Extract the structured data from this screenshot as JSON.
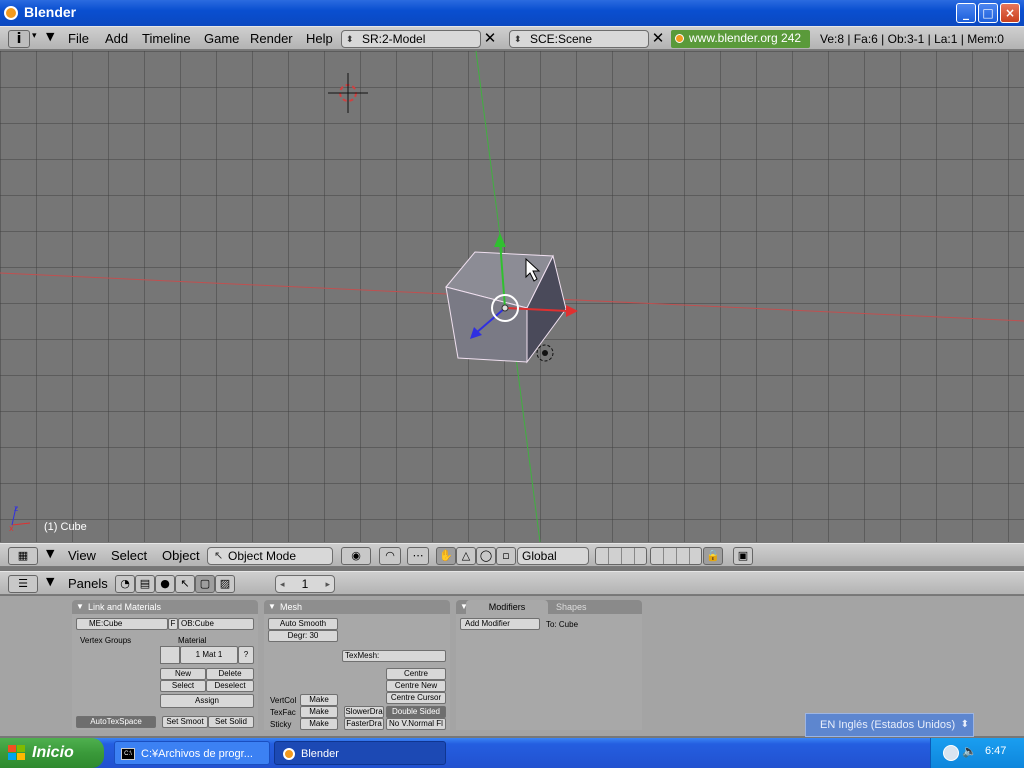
{
  "window": {
    "title": "Blender",
    "minimize": "_",
    "maximize": "□",
    "close": "×"
  },
  "top_header": {
    "menu": [
      "File",
      "Add",
      "Timeline",
      "Game",
      "Render",
      "Help"
    ],
    "screen_field": "SR:2-Model",
    "scene_field": "SCE:Scene",
    "close_glyph": "✕",
    "url_text": "www.blender.org 242",
    "stats": "Ve:8 | Fa:6 | Ob:3-1 | La:1 | Mem:0"
  },
  "viewport": {
    "caption": "(1) Cube",
    "axis_x": "x",
    "axis_z": "z",
    "colors": {
      "x_axis": "#e03030",
      "y_axis": "#30c030",
      "z_axis": "#3030e0",
      "background": "#767676"
    }
  },
  "view3d_header": {
    "menu": [
      "View",
      "Select",
      "Object"
    ],
    "mode": "Object Mode",
    "orientation": "Global"
  },
  "buttons_header": {
    "panels_label": "Panels",
    "frame_value": "1",
    "left_arrow": "◂",
    "right_arrow": "▸"
  },
  "panels": {
    "link_materials": {
      "title": "Link and Materials",
      "me_field": "ME:Cube",
      "f_label": "F",
      "ob_field": "OB:Cube",
      "vertex_groups": "Vertex Groups",
      "material_label": "Material",
      "mat_value": "1 Mat 1",
      "q_label": "?",
      "new": "New",
      "delete": "Delete",
      "select": "Select",
      "deselect": "Deselect",
      "assign": "Assign",
      "autotexspace": "AutoTexSpace",
      "set_smooth": "Set Smoot",
      "set_solid": "Set Solid"
    },
    "mesh": {
      "title": "Mesh",
      "auto_smooth": "Auto Smooth",
      "degr": "Degr: 30",
      "texmesh": "TexMesh:",
      "centre": "Centre",
      "centre_new": "Centre New",
      "centre_cursor": "Centre Cursor",
      "vertcol": "VertCol",
      "texface": "TexFac",
      "sticky": "Sticky",
      "make": "Make",
      "slower": "SlowerDra",
      "faster": "FasterDra",
      "double_sided": "Double Sided",
      "no_normal": "No V.Normal Fl"
    },
    "modifiers": {
      "tab_modifiers": "Modifiers",
      "tab_shapes": "Shapes",
      "add_modifier": "Add Modifier",
      "to_label": "To: Cube"
    }
  },
  "language_bar": {
    "text": "EN Inglés (Estados Unidos)"
  },
  "taskbar": {
    "start": "Inicio",
    "tasks": [
      {
        "label": "C:¥Archivos de progr..."
      },
      {
        "label": "Blender"
      }
    ],
    "clock": "6:47"
  }
}
